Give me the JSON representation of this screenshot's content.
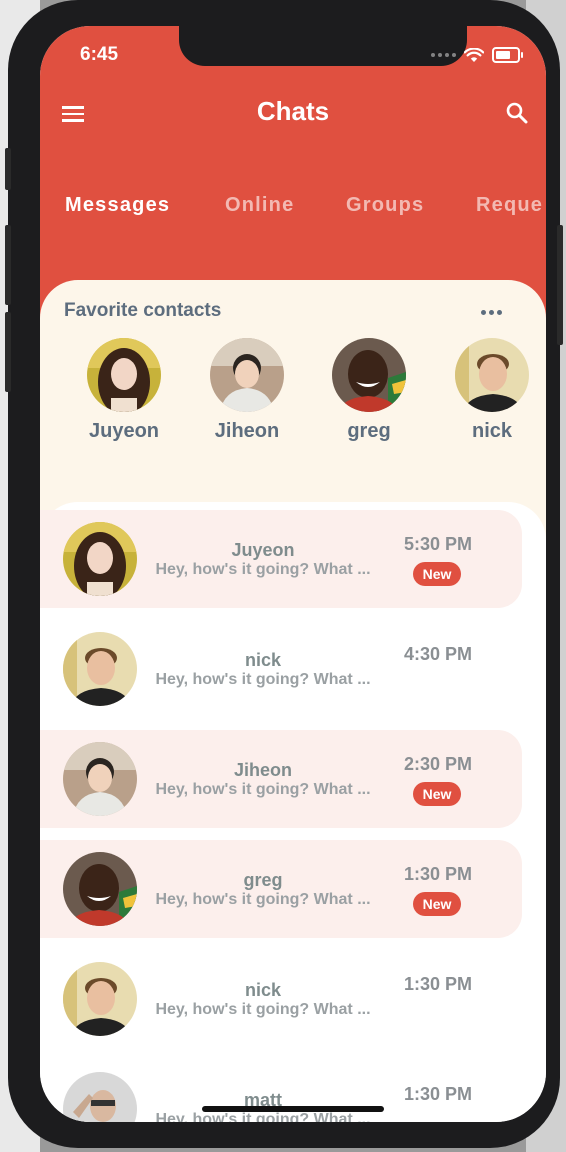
{
  "status_bar": {
    "time": "6:45"
  },
  "header": {
    "title": "Chats",
    "menu_icon": "hamburger-menu-icon",
    "search_icon": "search-icon",
    "background_color": "#e05040"
  },
  "tabs": [
    {
      "label": "Messages",
      "active": true
    },
    {
      "label": "Online",
      "active": false
    },
    {
      "label": "Groups",
      "active": false
    },
    {
      "label": "Reque",
      "active": false
    }
  ],
  "favorites": {
    "title": "Favorite contacts",
    "more_icon": "more-horizontal-icon",
    "contacts": [
      {
        "name": "Juyeon"
      },
      {
        "name": "Jiheon"
      },
      {
        "name": "greg"
      },
      {
        "name": "nick"
      }
    ]
  },
  "chats": [
    {
      "name": "Juyeon",
      "message": "Hey, how's it going? What ...",
      "time": "5:30 PM",
      "badge": "New",
      "unread": true
    },
    {
      "name": "nick",
      "message": "Hey, how's it going? What ...",
      "time": "4:30 PM",
      "badge": "",
      "unread": false
    },
    {
      "name": "Jiheon",
      "message": "Hey, how's it going? What ...",
      "time": "2:30 PM",
      "badge": "New",
      "unread": true
    },
    {
      "name": "greg",
      "message": "Hey, how's it going? What ...",
      "time": "1:30 PM",
      "badge": "New",
      "unread": true
    },
    {
      "name": "nick",
      "message": "Hey, how's it going? What ...",
      "time": "1:30 PM",
      "badge": "",
      "unread": false
    },
    {
      "name": "matt",
      "message": "Hey, how's it going? What ...",
      "time": "1:30 PM",
      "badge": "",
      "unread": false
    }
  ]
}
